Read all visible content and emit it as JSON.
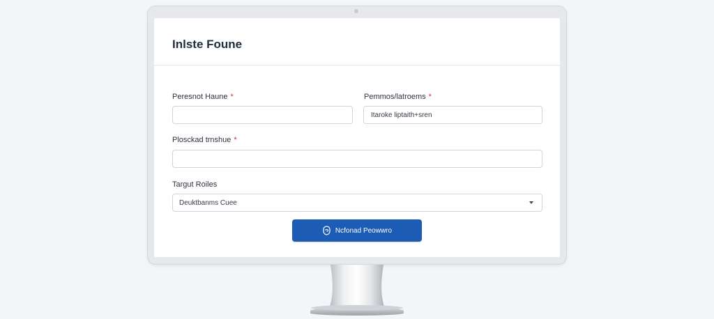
{
  "form": {
    "title": "Inlste Foune",
    "fields": {
      "personal_name": {
        "label": "Peresnot Haune",
        "value": ""
      },
      "permissions": {
        "label": "Pemmos/latroems",
        "value": "Itaroke liptaith+sren"
      },
      "placed": {
        "label": "Plosckad trnshue",
        "value": ""
      },
      "target_roles": {
        "label": "Targut Roiles",
        "value": "Deuktbanms Cuee"
      }
    },
    "submit_label": "Ncfonad Peowwro",
    "required_mark": "*"
  },
  "icons": {
    "submit": "shield-icon",
    "select_arrow": "chevron-down-icon"
  },
  "colors": {
    "accent": "#1c5cb4",
    "required": "#d62b2b",
    "title": "#1f2d3d"
  }
}
